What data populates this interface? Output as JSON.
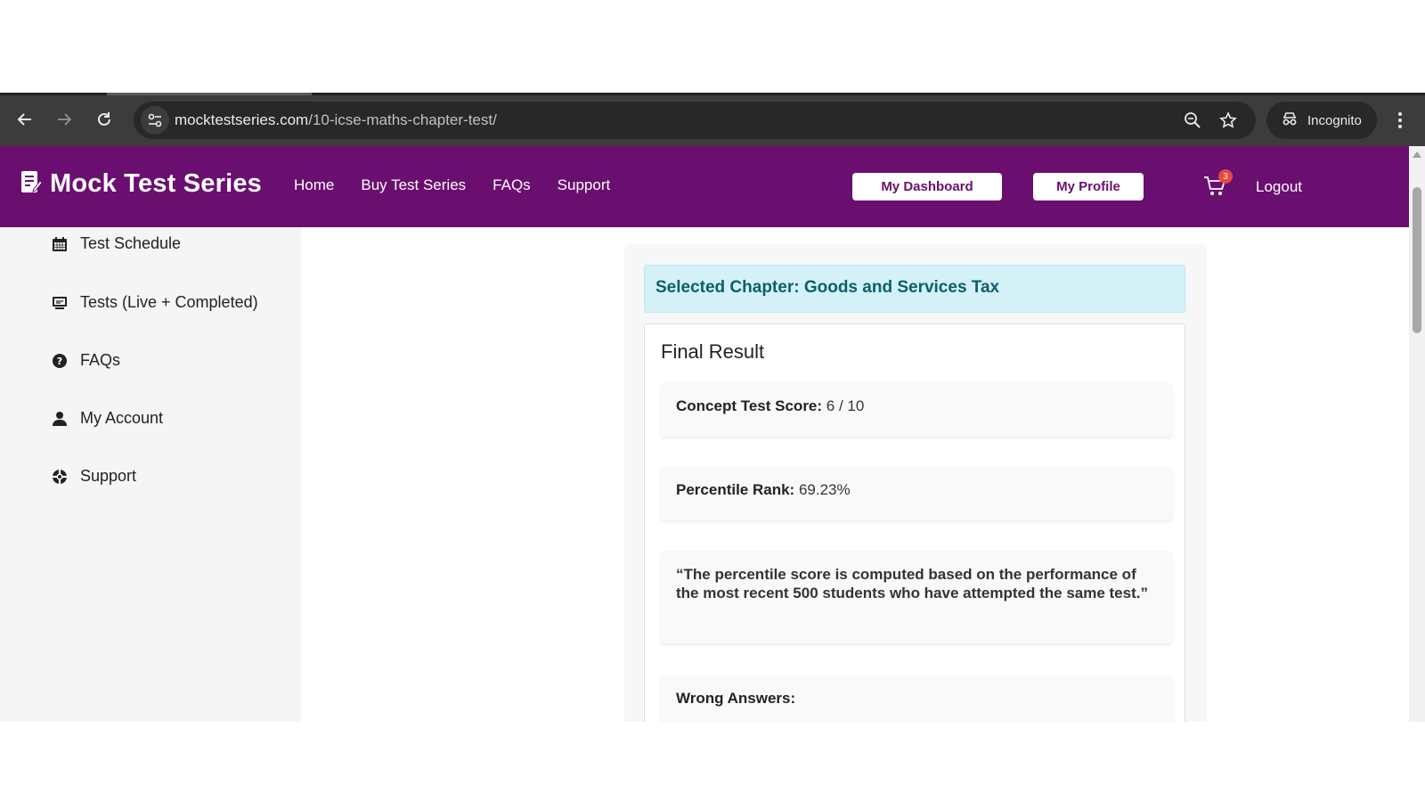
{
  "browser": {
    "url_host": "mocktestseries.com",
    "url_path": "/10-icse-maths-chapter-test/",
    "incognito_label": "Incognito"
  },
  "header": {
    "logo_text": "Mock Test Series",
    "nav": [
      "Home",
      "Buy Test Series",
      "FAQs",
      "Support"
    ],
    "dashboard_button": "My Dashboard",
    "profile_button": "My Profile",
    "cart_count": "3",
    "logout": "Logout",
    "brand_color": "#6a0f6f"
  },
  "sidebar": {
    "items": [
      {
        "label": "Test Schedule",
        "icon": "calendar-icon"
      },
      {
        "label": "Tests (Live + Completed)",
        "icon": "monitor-icon"
      },
      {
        "label": "FAQs",
        "icon": "question-icon"
      },
      {
        "label": "My Account",
        "icon": "user-icon"
      },
      {
        "label": "Support",
        "icon": "lifebuoy-icon"
      }
    ]
  },
  "main": {
    "chapter_banner": "Selected Chapter: Goods and Services Tax",
    "result_title": "Final Result",
    "score_label": "Concept Test Score:",
    "score_value": "6 / 10",
    "percentile_label": "Percentile Rank:",
    "percentile_value": "69.23%",
    "note": "“The percentile score is computed based on the performance of the most recent 500 students who have attempted the same test.”",
    "wrong_answers_label": "Wrong Answers:"
  }
}
